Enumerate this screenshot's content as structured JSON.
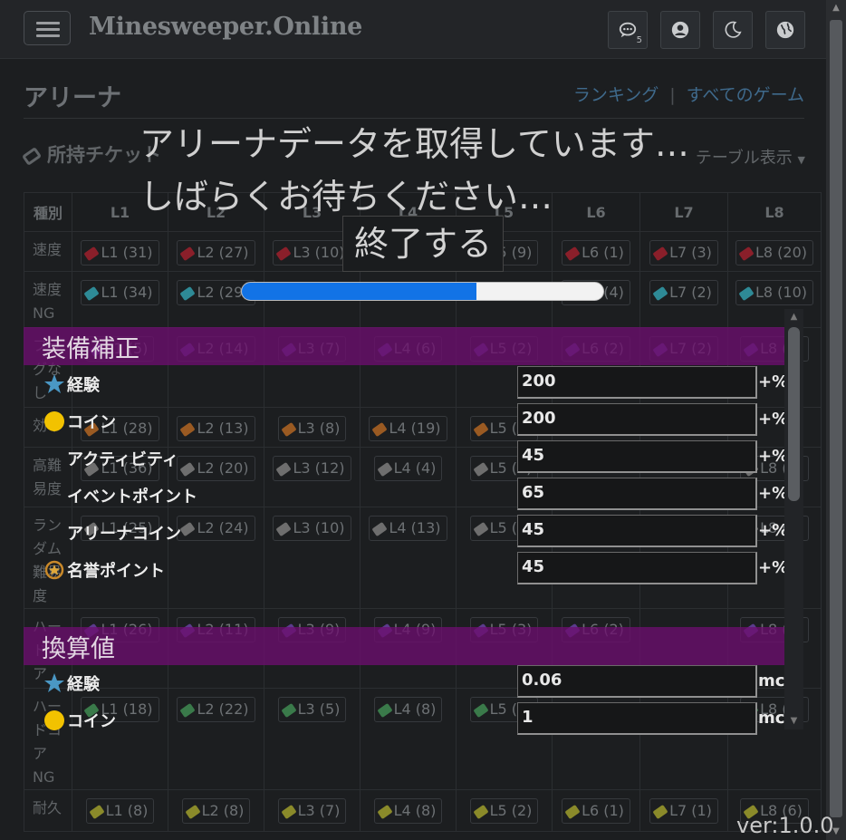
{
  "nav": {
    "brand": "Minesweeper.Online",
    "chat_count": "5",
    "icons": [
      "chat-icon",
      "user-icon",
      "moon-icon",
      "globe-icon"
    ]
  },
  "page": {
    "title": "アリーナ",
    "link_ranking": "ランキング",
    "link_separator": "|",
    "link_all_games": "すべてのゲーム",
    "tickets_header": "所持チケット",
    "table_view": "テーブル表示"
  },
  "table": {
    "headers": [
      "種別",
      "L1",
      "L2",
      "L3",
      "L4",
      "L5",
      "L6",
      "L7",
      "L8"
    ],
    "rows": [
      {
        "label": "速度",
        "color": "#8a1f2a",
        "cells": [
          "L1 (31)",
          "L2 (27)",
          "L3 (10)",
          "",
          "L5 (9)",
          "L6 (1)",
          "L7 (3)",
          "L8 (20)"
        ]
      },
      {
        "label": "速度 NG",
        "color": "#2e8a96",
        "cells": [
          "L1 (34)",
          "L2 (29)",
          "",
          "",
          "",
          "L6 (4)",
          "L7 (2)",
          "L8 (10)"
        ]
      },
      {
        "label": "フラグなし",
        "color": "#5b3b8c",
        "cells": [
          "L1 (5)",
          "L2 (14)",
          "L3 (7)",
          "L4 (6)",
          "L5 (2)",
          "L6 (2)",
          "L7 (2)",
          "L8 (1)"
        ]
      },
      {
        "label": "効率",
        "color": "#9a5a22",
        "cells": [
          "L1 (28)",
          "L2 (13)",
          "L3 (8)",
          "L4 (19)",
          "L5 (7)",
          "",
          "",
          ""
        ]
      },
      {
        "label": "高難易度",
        "color": "#6e6e6e",
        "cells": [
          "L1 (36)",
          "L2 (20)",
          "L3 (12)",
          "L4 (4)",
          "L5 (3)",
          "",
          "",
          "L8 (4)"
        ]
      },
      {
        "label": "ランダム難易度",
        "color": "#6e6e6e",
        "cells": [
          "L1 (25)",
          "L2 (24)",
          "L3 (10)",
          "L4 (13)",
          "L5 (7)",
          "",
          "",
          "L8 (1)"
        ]
      },
      {
        "label": "ハードコア",
        "color": "#5b3b8c",
        "cells": [
          "L1 (26)",
          "L2 (11)",
          "L3 (9)",
          "L4 (9)",
          "L5 (3)",
          "L6 (2)",
          "",
          "L8 (6)"
        ]
      },
      {
        "label": "ハードコア NG",
        "color": "#3a7a4a",
        "cells": [
          "L1 (18)",
          "L2 (22)",
          "L3 (5)",
          "L4 (8)",
          "L5 (6)",
          "",
          "",
          "L8 (1)"
        ]
      },
      {
        "label": "耐久",
        "color": "#8a8a2a",
        "cells": [
          "L1 (8)",
          "L2 (8)",
          "L3 (7)",
          "L4 (8)",
          "L5 (2)",
          "L6 (1)",
          "L7 (1)",
          "L8 (6)"
        ]
      }
    ]
  },
  "loading": {
    "line1": "アリーナデータを取得しています…",
    "line2": "しばらくお待ちください…",
    "stop_label": "終了する",
    "progress": 0.65
  },
  "equipment": {
    "title": "装備補正",
    "rows": [
      {
        "icon": "star-icon",
        "label": "経験",
        "value": "200",
        "unit": "+%"
      },
      {
        "icon": "coin-icon",
        "label": "コイン",
        "value": "200",
        "unit": "+%"
      },
      {
        "icon": "",
        "label": "アクティビティ",
        "value": "45",
        "unit": "+%"
      },
      {
        "icon": "",
        "label": "イベントポイント",
        "value": "65",
        "unit": "+%"
      },
      {
        "icon": "",
        "label": "アリーナコイン",
        "value": "45",
        "unit": "+%"
      },
      {
        "icon": "medal-icon",
        "label": "名誉ポイント",
        "value": "45",
        "unit": "+%"
      }
    ]
  },
  "conversion": {
    "title": "換算値",
    "rows": [
      {
        "icon": "star-icon",
        "label": "経験",
        "value": "0.06",
        "unit": "mc"
      },
      {
        "icon": "coin-icon",
        "label": "コイン",
        "value": "1",
        "unit": "mc"
      }
    ]
  },
  "version": "ver:1.0.0"
}
